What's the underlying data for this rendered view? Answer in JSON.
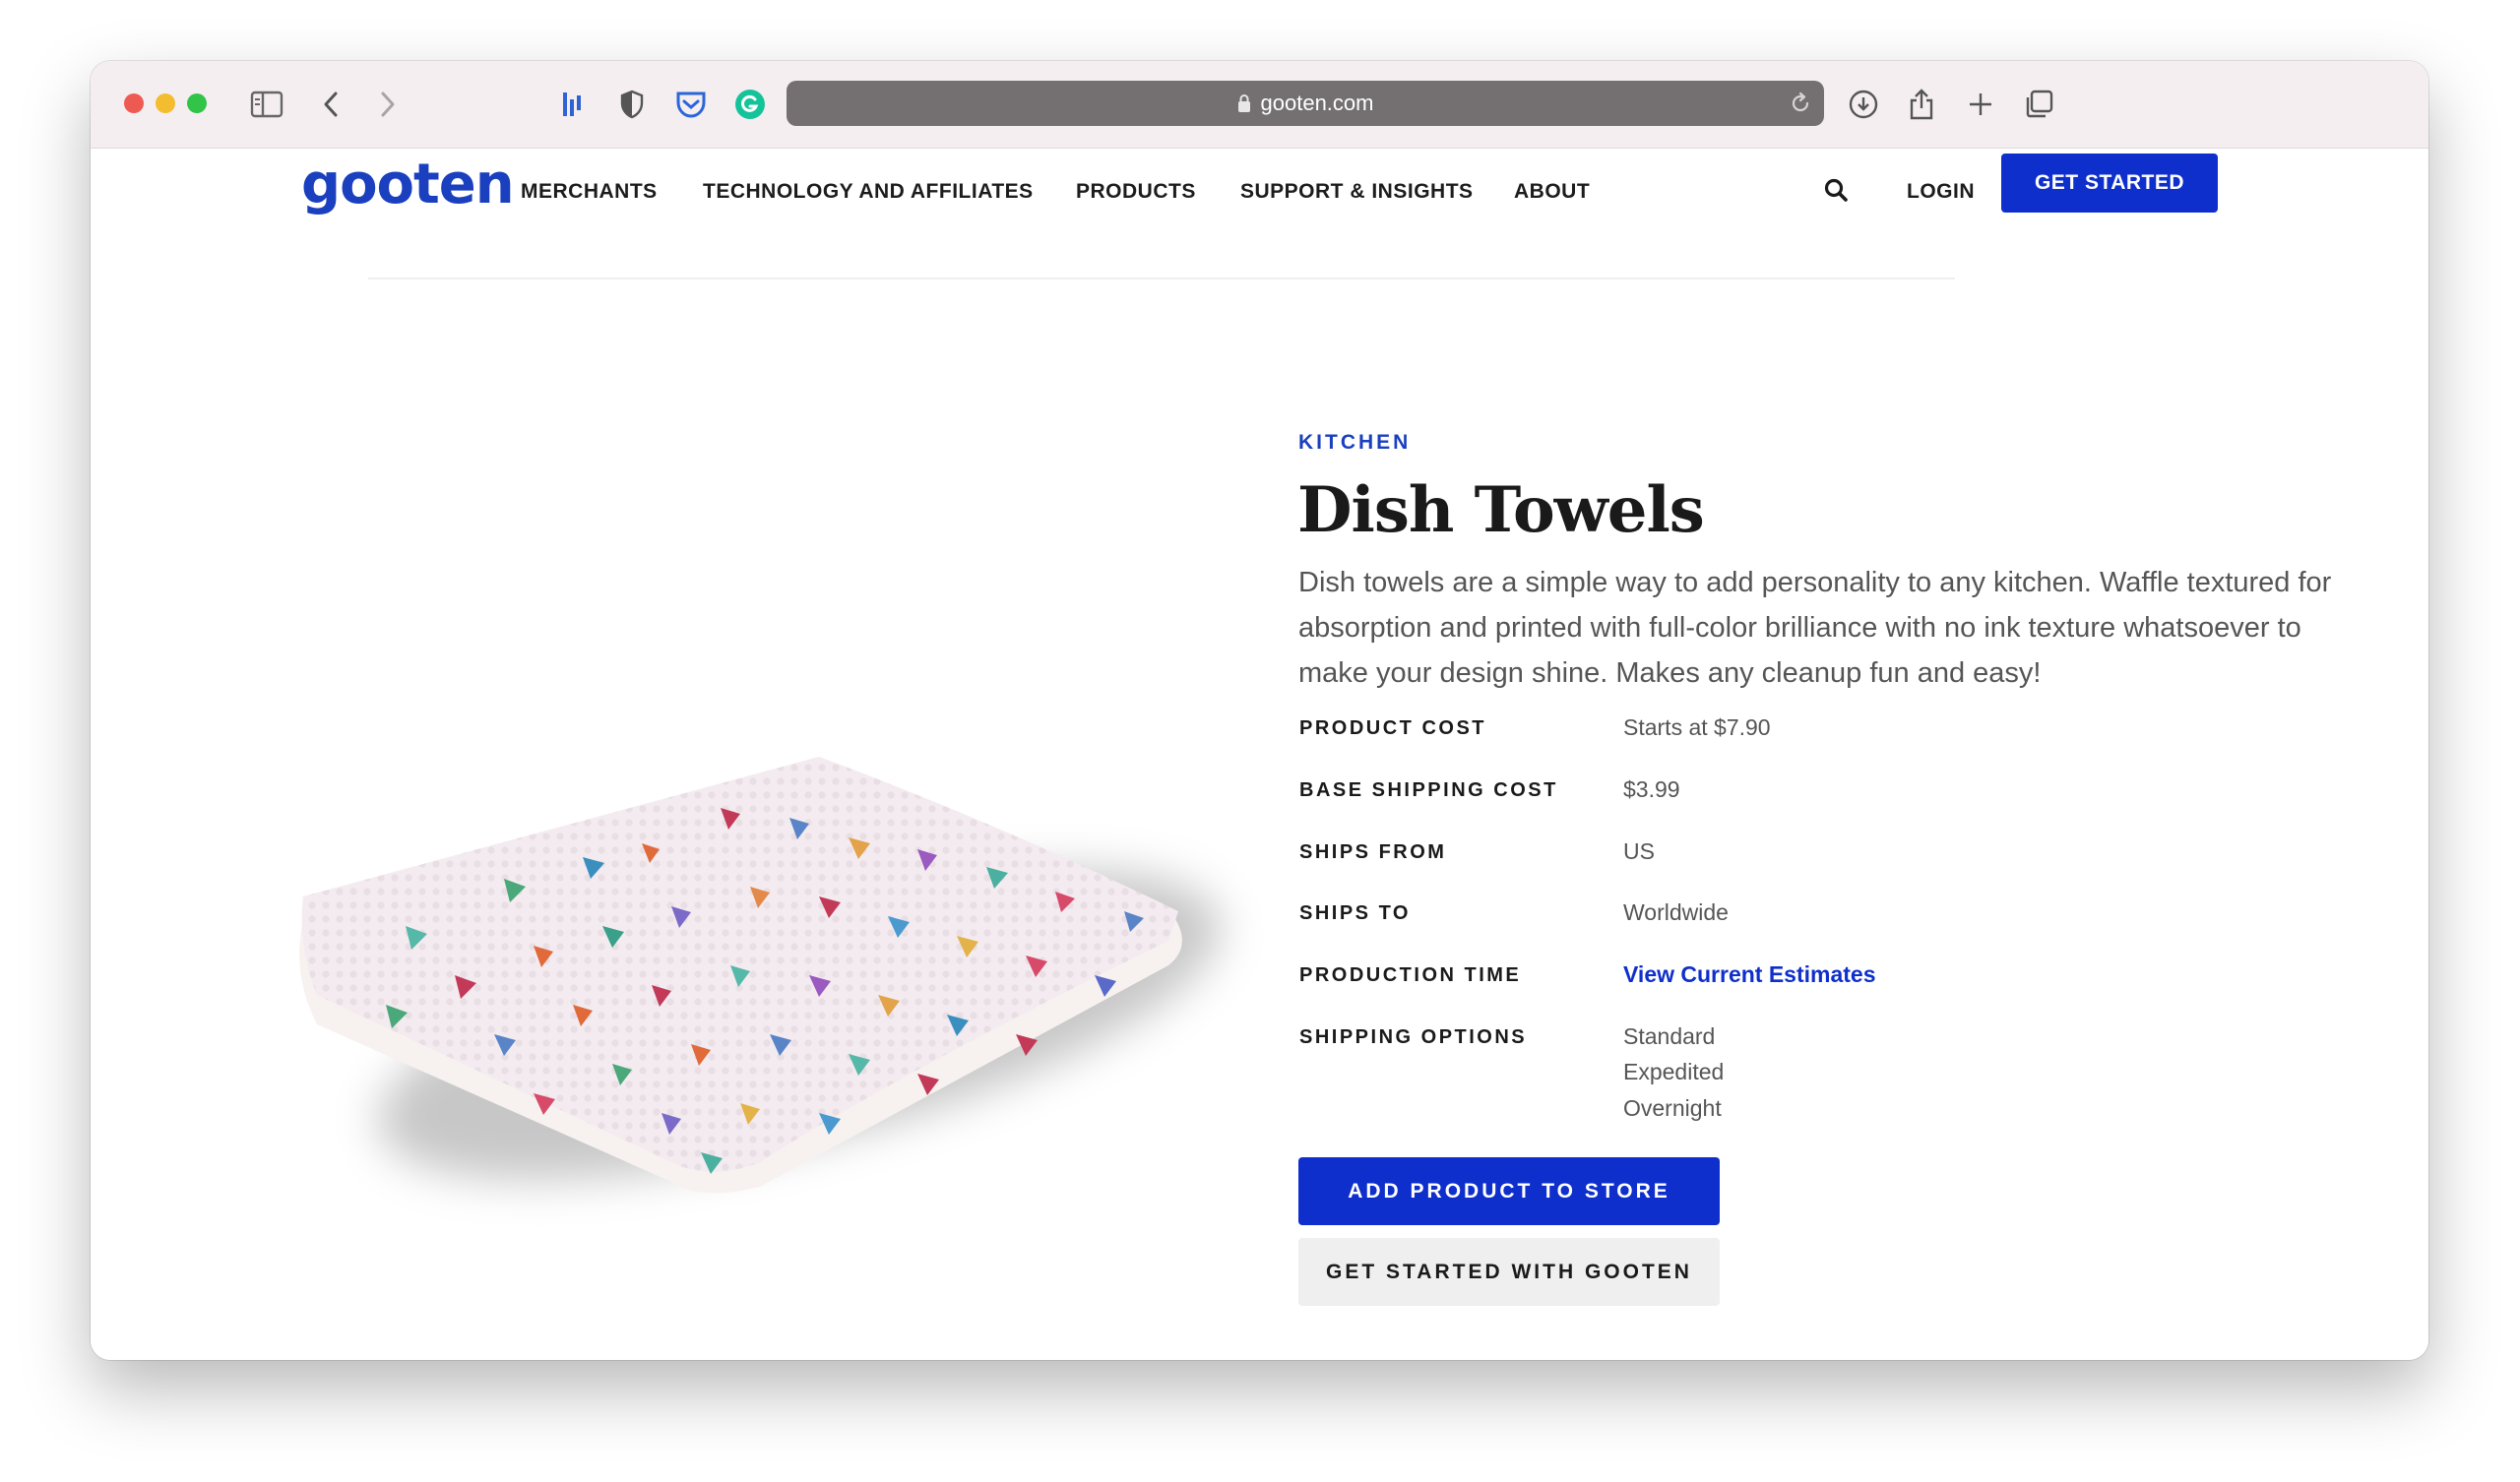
{
  "browser": {
    "url": "gooten.com",
    "colors": {
      "close": "#ee5a52",
      "minimize": "#f4bc2f",
      "zoom": "#32c448"
    },
    "icons": [
      "sidebar-icon",
      "back-icon",
      "forward-icon",
      "extension-icon",
      "shield-icon",
      "pocket-icon",
      "grammarly-icon",
      "lock-icon",
      "reload-icon",
      "download-icon",
      "share-icon",
      "new-tab-icon",
      "tabs-overview-icon"
    ]
  },
  "nav": {
    "logo": "gooten",
    "items": [
      "MERCHANTS",
      "TECHNOLOGY AND AFFILIATES",
      "PRODUCTS",
      "SUPPORT & INSIGHTS",
      "ABOUT"
    ],
    "login": "LOGIN",
    "cta": "GET STARTED"
  },
  "product": {
    "category": "KITCHEN",
    "title": "Dish Towels",
    "description": "Dish towels are a simple way to add personality to any kitchen. Waffle textured for absorption and printed with full-color brilliance with no ink texture whatsoever to make your design shine. Makes any cleanup fun and easy!",
    "specs": [
      {
        "label": "PRODUCT COST",
        "value": "Starts at $7.90"
      },
      {
        "label": "BASE SHIPPING COST",
        "value": "$3.99"
      },
      {
        "label": "SHIPS FROM",
        "value": "US"
      },
      {
        "label": "SHIPS TO",
        "value": "Worldwide"
      },
      {
        "label": "PRODUCTION TIME",
        "value": "View Current Estimates"
      },
      {
        "label": "SHIPPING OPTIONS",
        "values": [
          "Standard",
          "Expedited",
          "Overnight"
        ]
      }
    ],
    "add_button": "ADD PRODUCT TO STORE",
    "secondary_button": "GET STARTED WITH GOOTEN"
  },
  "colors": {
    "brand": "#0f2fcc",
    "text": "#1a1a1a",
    "muted": "#555555"
  }
}
